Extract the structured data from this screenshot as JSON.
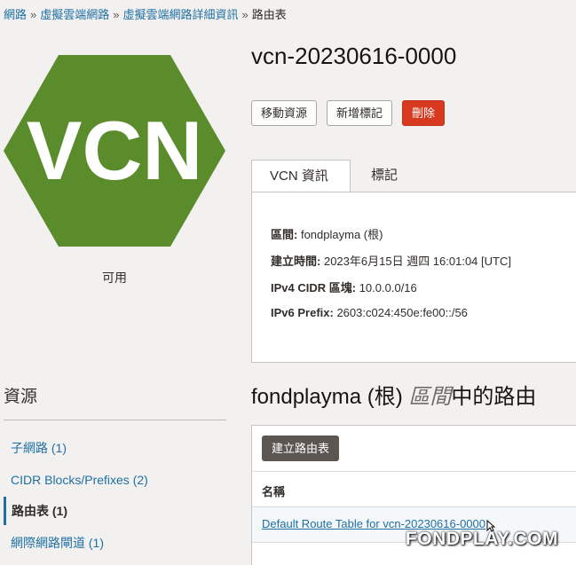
{
  "breadcrumb": {
    "items": [
      "網路",
      "虛擬雲端網路",
      "虛擬雲端網路詳細資訊"
    ],
    "current": "路由表",
    "separator": "»"
  },
  "vcn_icon": {
    "text": "VCN",
    "color": "#5a8c2b"
  },
  "status": "可用",
  "title": "vcn-20230616-0000",
  "buttons": {
    "move": "移動資源",
    "add_tag": "新增標記",
    "delete": "刪除"
  },
  "tabs": {
    "info": "VCN 資訊",
    "tags": "標記"
  },
  "info": {
    "compartment_label": "區間:",
    "compartment_value": "fondplayma (根)",
    "created_label": "建立時間:",
    "created_value": "2023年6月15日 週四 16:01:04 [UTC]",
    "ipv4_label": "IPv4 CIDR 區塊:",
    "ipv4_value": "10.0.0.0/16",
    "ipv6_label": "IPv6 Prefix:",
    "ipv6_value": "2603:c024:450e:fe00::/56"
  },
  "resources": {
    "title": "資源",
    "items": [
      "子網路 (1)",
      "CIDR Blocks/Prefixes (2)",
      "路由表 (1)",
      "網際網路閘道 (1)"
    ],
    "active_index": 2
  },
  "section": {
    "prefix": "fondplayma (根) ",
    "em": "區間",
    "suffix": "中的路由"
  },
  "table": {
    "create_button": "建立路由表",
    "column_name": "名稱",
    "rows": [
      "Default Route Table for vcn-20230616-0000"
    ]
  },
  "watermark": "FONDPLAY.COM",
  "colors": {
    "link": "#1f6fa3",
    "danger": "#d73a1f",
    "vcn_green": "#5a8c2b"
  }
}
